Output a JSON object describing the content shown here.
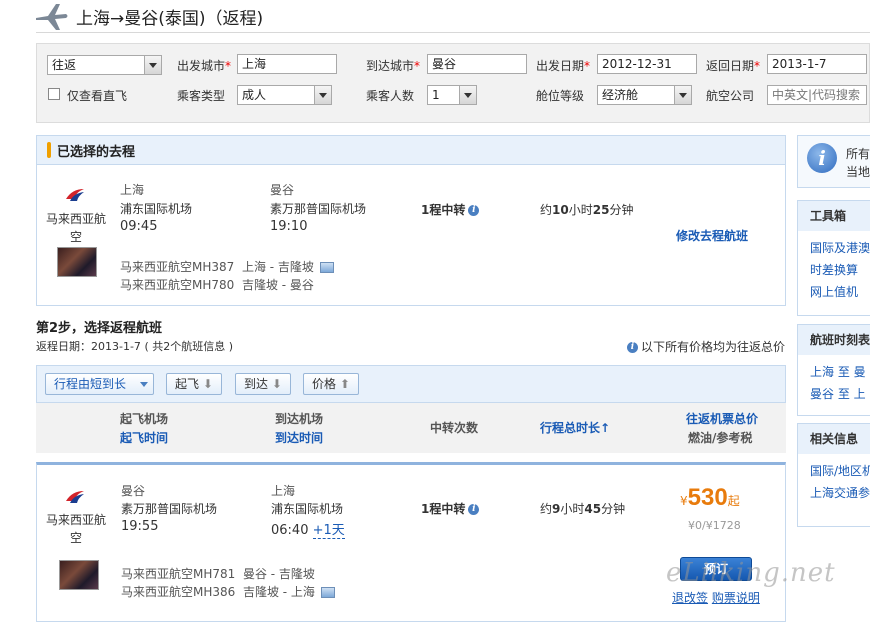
{
  "header": {
    "title": "上海→曼谷(泰国)（返程)"
  },
  "search": {
    "trip_type": "往返",
    "direct_only_label": "仅查看直飞",
    "depart_city_label": "出发城市",
    "depart_city_value": "上海",
    "arrive_city_label": "到达城市",
    "arrive_city_value": "曼谷",
    "depart_date_label": "出发日期",
    "depart_date_value": "2012-12-31",
    "return_date_label": "返回日期",
    "return_date_value": "2013-1-7",
    "passenger_type_label": "乘客类型",
    "passenger_type_value": "成人",
    "passenger_count_label": "乘客人数",
    "passenger_count_value": "1",
    "cabin_label": "舱位等级",
    "cabin_value": "经济舱",
    "airline_label": "航空公司",
    "airline_placeholder": "中英文|代码搜索"
  },
  "selected": {
    "title": "已选择的去程",
    "airline": "马来西亚航空",
    "dep_city": "上海",
    "dep_airport": "浦东国际机场",
    "dep_time": "09:45",
    "arr_city": "曼谷",
    "arr_airport": "素万那普国际机场",
    "arr_time": "19:10",
    "transfer": "1程中转",
    "duration_prefix": "约",
    "duration_h": "10",
    "duration_hour_unit": "小时",
    "duration_m": "25",
    "duration_min_unit": "分钟",
    "modify_link": "修改去程航班",
    "seg1_flight": "马来西亚航空MH387",
    "seg1_route": "上海 - 吉隆坡",
    "seg2_flight": "马来西亚航空MH780",
    "seg2_route": "吉隆坡 - 曼谷"
  },
  "step2": {
    "title": "第2步，选择返程航班",
    "return_date_label": "返程日期：",
    "return_date": "2013-1-7",
    "count_text": "( 共2个航班信息 )",
    "price_note": "以下所有价格均为往返总价"
  },
  "sortbar": {
    "sort_select": "行程由短到长",
    "depart_btn": "起飞",
    "arrive_btn": "到达",
    "price_btn": "价格"
  },
  "columns": {
    "dep_airport": "起飞机场",
    "dep_time": "起飞时间",
    "arr_airport": "到达机场",
    "arr_time": "到达时间",
    "transfers": "中转次数",
    "duration": "行程总时长",
    "price_main": "往返机票总价",
    "price_sub": "燃油/参考税"
  },
  "result": {
    "airline": "马来西亚航空",
    "dep_city": "曼谷",
    "dep_airport": "素万那普国际机场",
    "dep_time": "19:55",
    "arr_city": "上海",
    "arr_airport": "浦东国际机场",
    "arr_time": "06:40",
    "next_day": "+1天",
    "transfer": "1程中转",
    "duration_prefix": "约",
    "duration_h": "9",
    "duration_hour_unit": "小时",
    "duration_m": "45",
    "duration_min_unit": "分钟",
    "currency": "¥",
    "price": "530",
    "price_suffix": "起",
    "tax": "¥0/¥1728",
    "book_btn": "预订",
    "refund_link": "退改签",
    "policy_link": "购票说明",
    "seg1_flight": "马来西亚航空MH781",
    "seg1_route": "曼谷 - 吉隆坡",
    "seg2_flight": "马来西亚航空MH386",
    "seg2_route": "吉隆坡 - 上海"
  },
  "sidebar": {
    "notice_line1": "所有",
    "notice_line2": "当地",
    "tools_title": "工具箱",
    "tools": [
      "国际及港澳",
      "时差换算",
      "网上值机"
    ],
    "schedule_title": "航班时刻表",
    "schedule": [
      "上海 至 曼",
      "曼谷 至 上"
    ],
    "info_title": "相关信息",
    "info": [
      "国际/地区机",
      "上海交通参"
    ]
  },
  "watermark": "eLiiking.net",
  "colors": {
    "link": "#1a5bb5",
    "price": "#e87b0c",
    "panel_header": "#e8f1fb",
    "book": "#1565c0"
  }
}
